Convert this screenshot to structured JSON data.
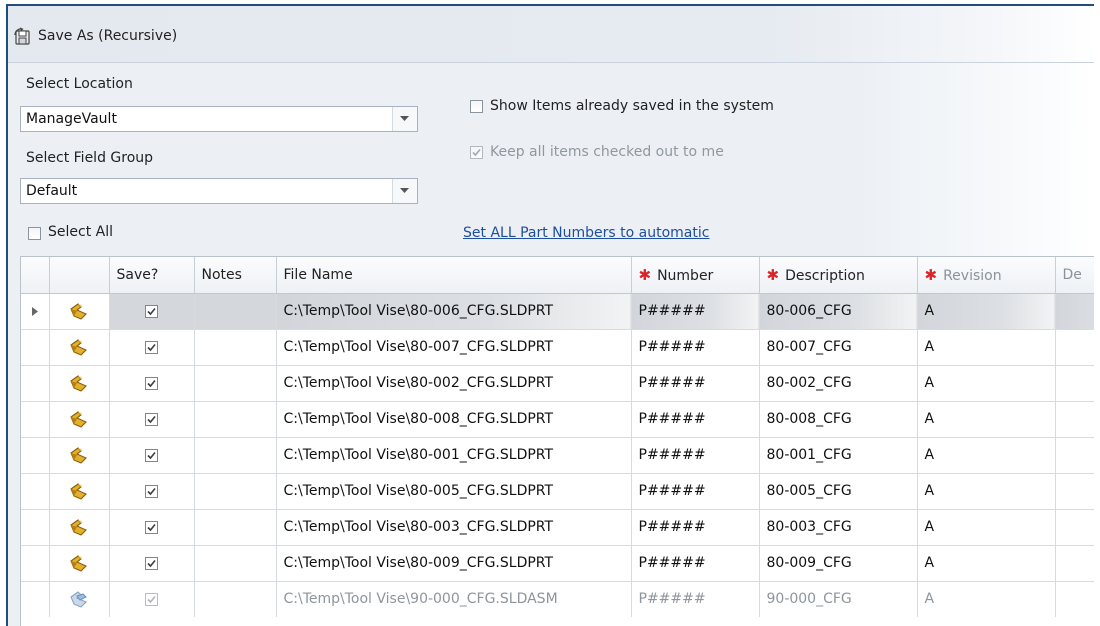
{
  "window": {
    "title": "Save As (Recursive)"
  },
  "location": {
    "label": "Select Location",
    "value": "ManageVault"
  },
  "field_group": {
    "label": "Select Field Group",
    "value": "Default"
  },
  "options": {
    "show_saved_label": "Show Items already saved in the system",
    "show_saved_checked": false,
    "keep_checked_out_label": "Keep all items checked out to me",
    "keep_checked_out_checked": true
  },
  "select_all_label": "Select All",
  "set_auto_link": "Set ALL Part Numbers to automatic",
  "grid": {
    "columns": {
      "save": "Save?",
      "notes": "Notes",
      "file_name": "File Name",
      "number": "Number",
      "description": "Description",
      "revision": "Revision",
      "extra": "De"
    },
    "rows": [
      {
        "type": "part",
        "save": true,
        "notes": "",
        "file_name": "C:\\Temp\\Tool Vise\\80-006_CFG.SLDPRT",
        "number": "P#####",
        "description": "80-006_CFG",
        "revision": "A"
      },
      {
        "type": "part",
        "save": true,
        "notes": "",
        "file_name": "C:\\Temp\\Tool Vise\\80-007_CFG.SLDPRT",
        "number": "P#####",
        "description": "80-007_CFG",
        "revision": "A"
      },
      {
        "type": "part",
        "save": true,
        "notes": "",
        "file_name": "C:\\Temp\\Tool Vise\\80-002_CFG.SLDPRT",
        "number": "P#####",
        "description": "80-002_CFG",
        "revision": "A"
      },
      {
        "type": "part",
        "save": true,
        "notes": "",
        "file_name": "C:\\Temp\\Tool Vise\\80-008_CFG.SLDPRT",
        "number": "P#####",
        "description": "80-008_CFG",
        "revision": "A"
      },
      {
        "type": "part",
        "save": true,
        "notes": "",
        "file_name": "C:\\Temp\\Tool Vise\\80-001_CFG.SLDPRT",
        "number": "P#####",
        "description": "80-001_CFG",
        "revision": "A"
      },
      {
        "type": "part",
        "save": true,
        "notes": "",
        "file_name": "C:\\Temp\\Tool Vise\\80-005_CFG.SLDPRT",
        "number": "P#####",
        "description": "80-005_CFG",
        "revision": "A"
      },
      {
        "type": "part",
        "save": true,
        "notes": "",
        "file_name": "C:\\Temp\\Tool Vise\\80-003_CFG.SLDPRT",
        "number": "P#####",
        "description": "80-003_CFG",
        "revision": "A"
      },
      {
        "type": "part",
        "save": true,
        "notes": "",
        "file_name": "C:\\Temp\\Tool Vise\\80-009_CFG.SLDPRT",
        "number": "P#####",
        "description": "80-009_CFG",
        "revision": "A"
      },
      {
        "type": "assembly",
        "save": true,
        "notes": "",
        "file_name": "C:\\Temp\\Tool Vise\\90-000_CFG.SLDASM",
        "number": "P#####",
        "description": "90-000_CFG",
        "revision": "A"
      }
    ]
  },
  "colors": {
    "required_marker": "#d9252a",
    "link": "#1e4ea0",
    "part_icon": "#d9a21e",
    "assembly_icon": "#7ba6d6",
    "window_border": "#1f4e7a"
  },
  "icons": {
    "title": "save-recursive-icon",
    "part": "part-icon",
    "assembly": "assembly-icon",
    "dropdown": "chevron-down-icon",
    "row_pointer": "row-pointer-icon",
    "required": "required-asterisk-icon"
  }
}
